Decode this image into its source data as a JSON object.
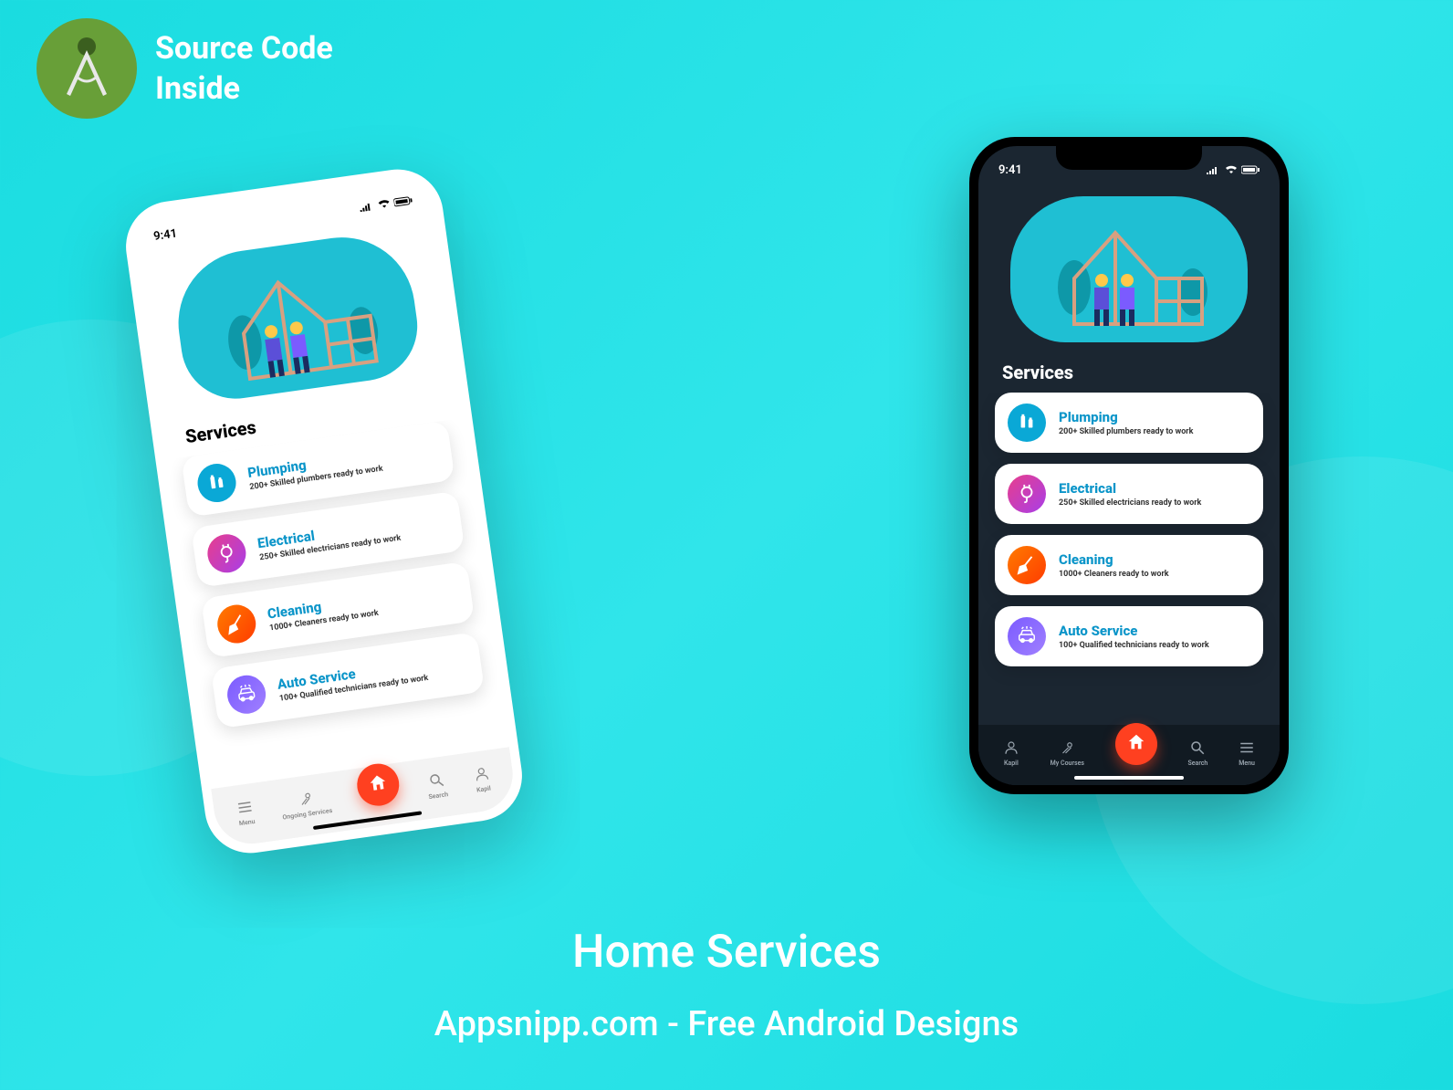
{
  "badge": {
    "line1": "Source Code",
    "line2": "Inside"
  },
  "status": {
    "time": "9:41"
  },
  "section_title": "Services",
  "services": [
    {
      "title": "Plumping",
      "subtitle": "200+ Skilled plumbers ready to work",
      "icon": "plumbing-icon",
      "color": "ic-plumb"
    },
    {
      "title": "Electrical",
      "subtitle": "250+ Skilled electricians ready to work",
      "icon": "plug-icon",
      "color": "ic-elec"
    },
    {
      "title": "Cleaning",
      "subtitle": "1000+ Cleaners ready to work",
      "icon": "broom-icon",
      "color": "ic-clean"
    },
    {
      "title": "Auto Service",
      "subtitle": "100+ Qualified technicians ready to work",
      "icon": "car-icon",
      "color": "ic-auto"
    }
  ],
  "nav_light": [
    {
      "label": "Menu",
      "icon": "menu-icon"
    },
    {
      "label": "Ongoing Services",
      "icon": "tools-icon"
    },
    {
      "label": "Search",
      "icon": "search-icon"
    },
    {
      "label": "Kapil",
      "icon": "user-icon"
    }
  ],
  "nav_dark": [
    {
      "label": "Kapil",
      "icon": "user-icon"
    },
    {
      "label": "My Courses",
      "icon": "tools-icon"
    },
    {
      "label": "Search",
      "icon": "search-icon"
    },
    {
      "label": "Menu",
      "icon": "menu-icon"
    }
  ],
  "footer": {
    "title": "Home Services",
    "subtitle": "Appsnipp.com - Free Android Designs"
  }
}
